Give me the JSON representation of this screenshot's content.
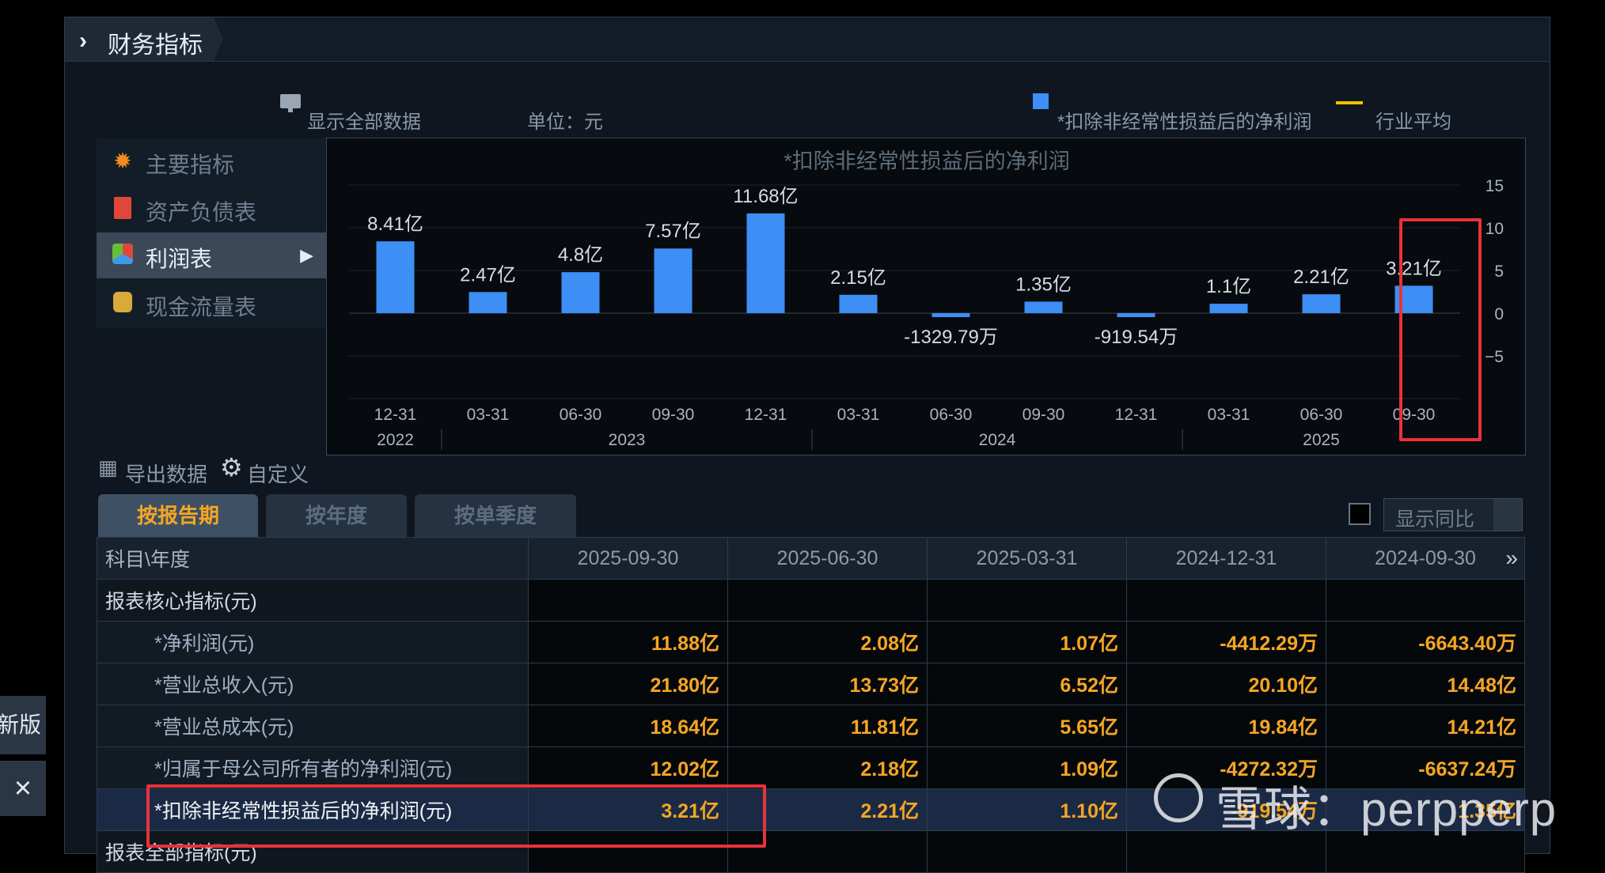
{
  "panel": {
    "title": "财务指标"
  },
  "toolbar": {
    "show_all": "显示全部数据",
    "unit": "单位：元",
    "legend_series": "*扣除非经常性损益后的净利润",
    "legend_avg": "行业平均"
  },
  "nav": {
    "items": [
      {
        "label": "主要指标"
      },
      {
        "label": "资产负债表"
      },
      {
        "label": "利润表"
      },
      {
        "label": "现金流量表"
      }
    ]
  },
  "colors": {
    "bar": "#3d8ef5",
    "avg_line": "#f2c200",
    "value_text": "#f5a623",
    "highlight_box": "#e8323b"
  },
  "chart_data": {
    "type": "bar",
    "title": "*扣除非经常性损益后的净利润",
    "categories": [
      "12-31",
      "03-31",
      "06-30",
      "09-30",
      "12-31",
      "03-31",
      "06-30",
      "09-30",
      "12-31",
      "03-31",
      "06-30",
      "09-30"
    ],
    "years": [
      "2022",
      "2023",
      "2024",
      "2025"
    ],
    "series": [
      {
        "values": [
          8.41,
          2.47,
          4.8,
          7.57,
          11.68,
          2.15,
          -0.132979,
          1.35,
          -0.091954,
          1.1,
          2.21,
          3.21
        ]
      }
    ],
    "data_labels": [
      "8.41亿",
      "2.47亿",
      "4.8亿",
      "7.57亿",
      "11.68亿",
      "2.15亿",
      "-1329.79万",
      "1.35亿",
      "-919.54万",
      "1.1亿",
      "2.21亿",
      "3.21亿"
    ],
    "yticks": [
      "15",
      "10",
      "5",
      "0",
      "−5"
    ],
    "ylim": [
      -10,
      15
    ],
    "grid": true
  },
  "actions": {
    "export": "导出数据",
    "custom": "自定义"
  },
  "tabs": [
    {
      "label": "按报告期"
    },
    {
      "label": "按年度"
    },
    {
      "label": "按单季度"
    }
  ],
  "compare": {
    "label": "显示同比"
  },
  "table": {
    "corner": "科目\\年度",
    "dates": [
      "2025-09-30",
      "2025-06-30",
      "2025-03-31",
      "2024-12-31",
      "2024-09-30"
    ],
    "section": "报表核心指标(元)",
    "rows": [
      {
        "name": "*净利润(元)",
        "values": [
          "11.88亿",
          "2.08亿",
          "1.07亿",
          "-4412.29万",
          "-6643.40万"
        ]
      },
      {
        "name": "*营业总收入(元)",
        "values": [
          "21.80亿",
          "13.73亿",
          "6.52亿",
          "20.10亿",
          "14.48亿"
        ]
      },
      {
        "name": "*营业总成本(元)",
        "values": [
          "18.64亿",
          "11.81亿",
          "5.65亿",
          "19.84亿",
          "14.21亿"
        ]
      },
      {
        "name": "*归属于母公司所有者的净利润(元)",
        "values": [
          "12.02亿",
          "2.18亿",
          "1.09亿",
          "-4272.32万",
          "-6637.24万"
        ]
      },
      {
        "name": "*扣除非经常性损益后的净利润(元)",
        "values": [
          "3.21亿",
          "2.21亿",
          "1.10亿",
          "-919.54万",
          "1.35亿"
        ]
      }
    ],
    "partial_row": "报表全部指标(元)"
  },
  "side": {
    "new_version": "新版",
    "close": "×"
  },
  "watermark": {
    "text": "雪球：perpperp"
  }
}
